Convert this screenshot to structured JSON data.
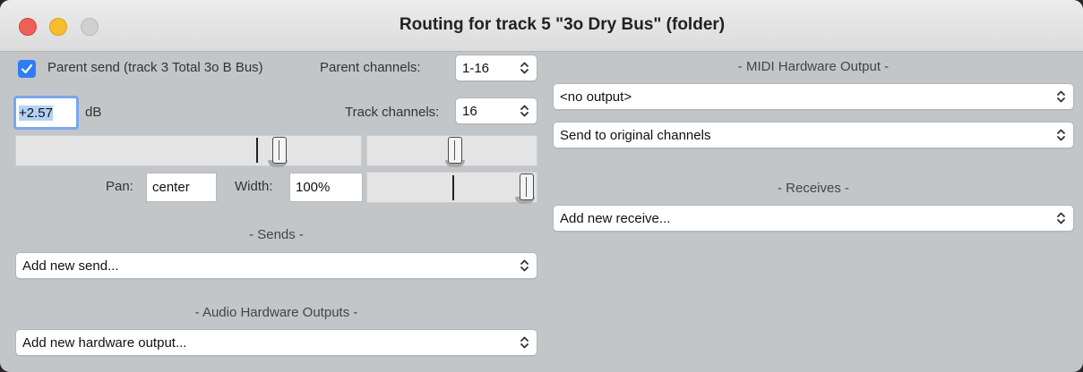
{
  "window": {
    "title": "Routing for track 5 \"3o Dry Bus\" (folder)"
  },
  "left": {
    "parent_send_label": "Parent send (track 3 Total 3o B Bus)",
    "parent_send_checked": true,
    "parent_channels_label": "Parent channels:",
    "parent_channels_value": "1-16",
    "volume_value": "+2.57",
    "volume_unit": "dB",
    "track_channels_label": "Track channels:",
    "track_channels_value": "16",
    "pan_label": "Pan:",
    "pan_value": "center",
    "width_label": "Width:",
    "width_value": "100%",
    "sends_heading": "- Sends -",
    "sends_select": "Add new send...",
    "audio_hw_heading": "- Audio Hardware Outputs -",
    "audio_hw_select": "Add new hardware output..."
  },
  "right": {
    "midi_heading": "- MIDI Hardware Output -",
    "midi_output_select": "<no output>",
    "midi_channels_select": "Send to original channels",
    "receives_heading": "- Receives -",
    "receives_select": "Add new receive..."
  },
  "colors": {
    "window_bg": "#c3c6c8",
    "checkbox_accent": "#2f7df6",
    "focus_ring": "#7aa7ee"
  },
  "icons": [
    "close-window-icon",
    "minimize-window-icon",
    "maximize-window-icon",
    "checkmark-icon",
    "updown-chevron-icon"
  ]
}
